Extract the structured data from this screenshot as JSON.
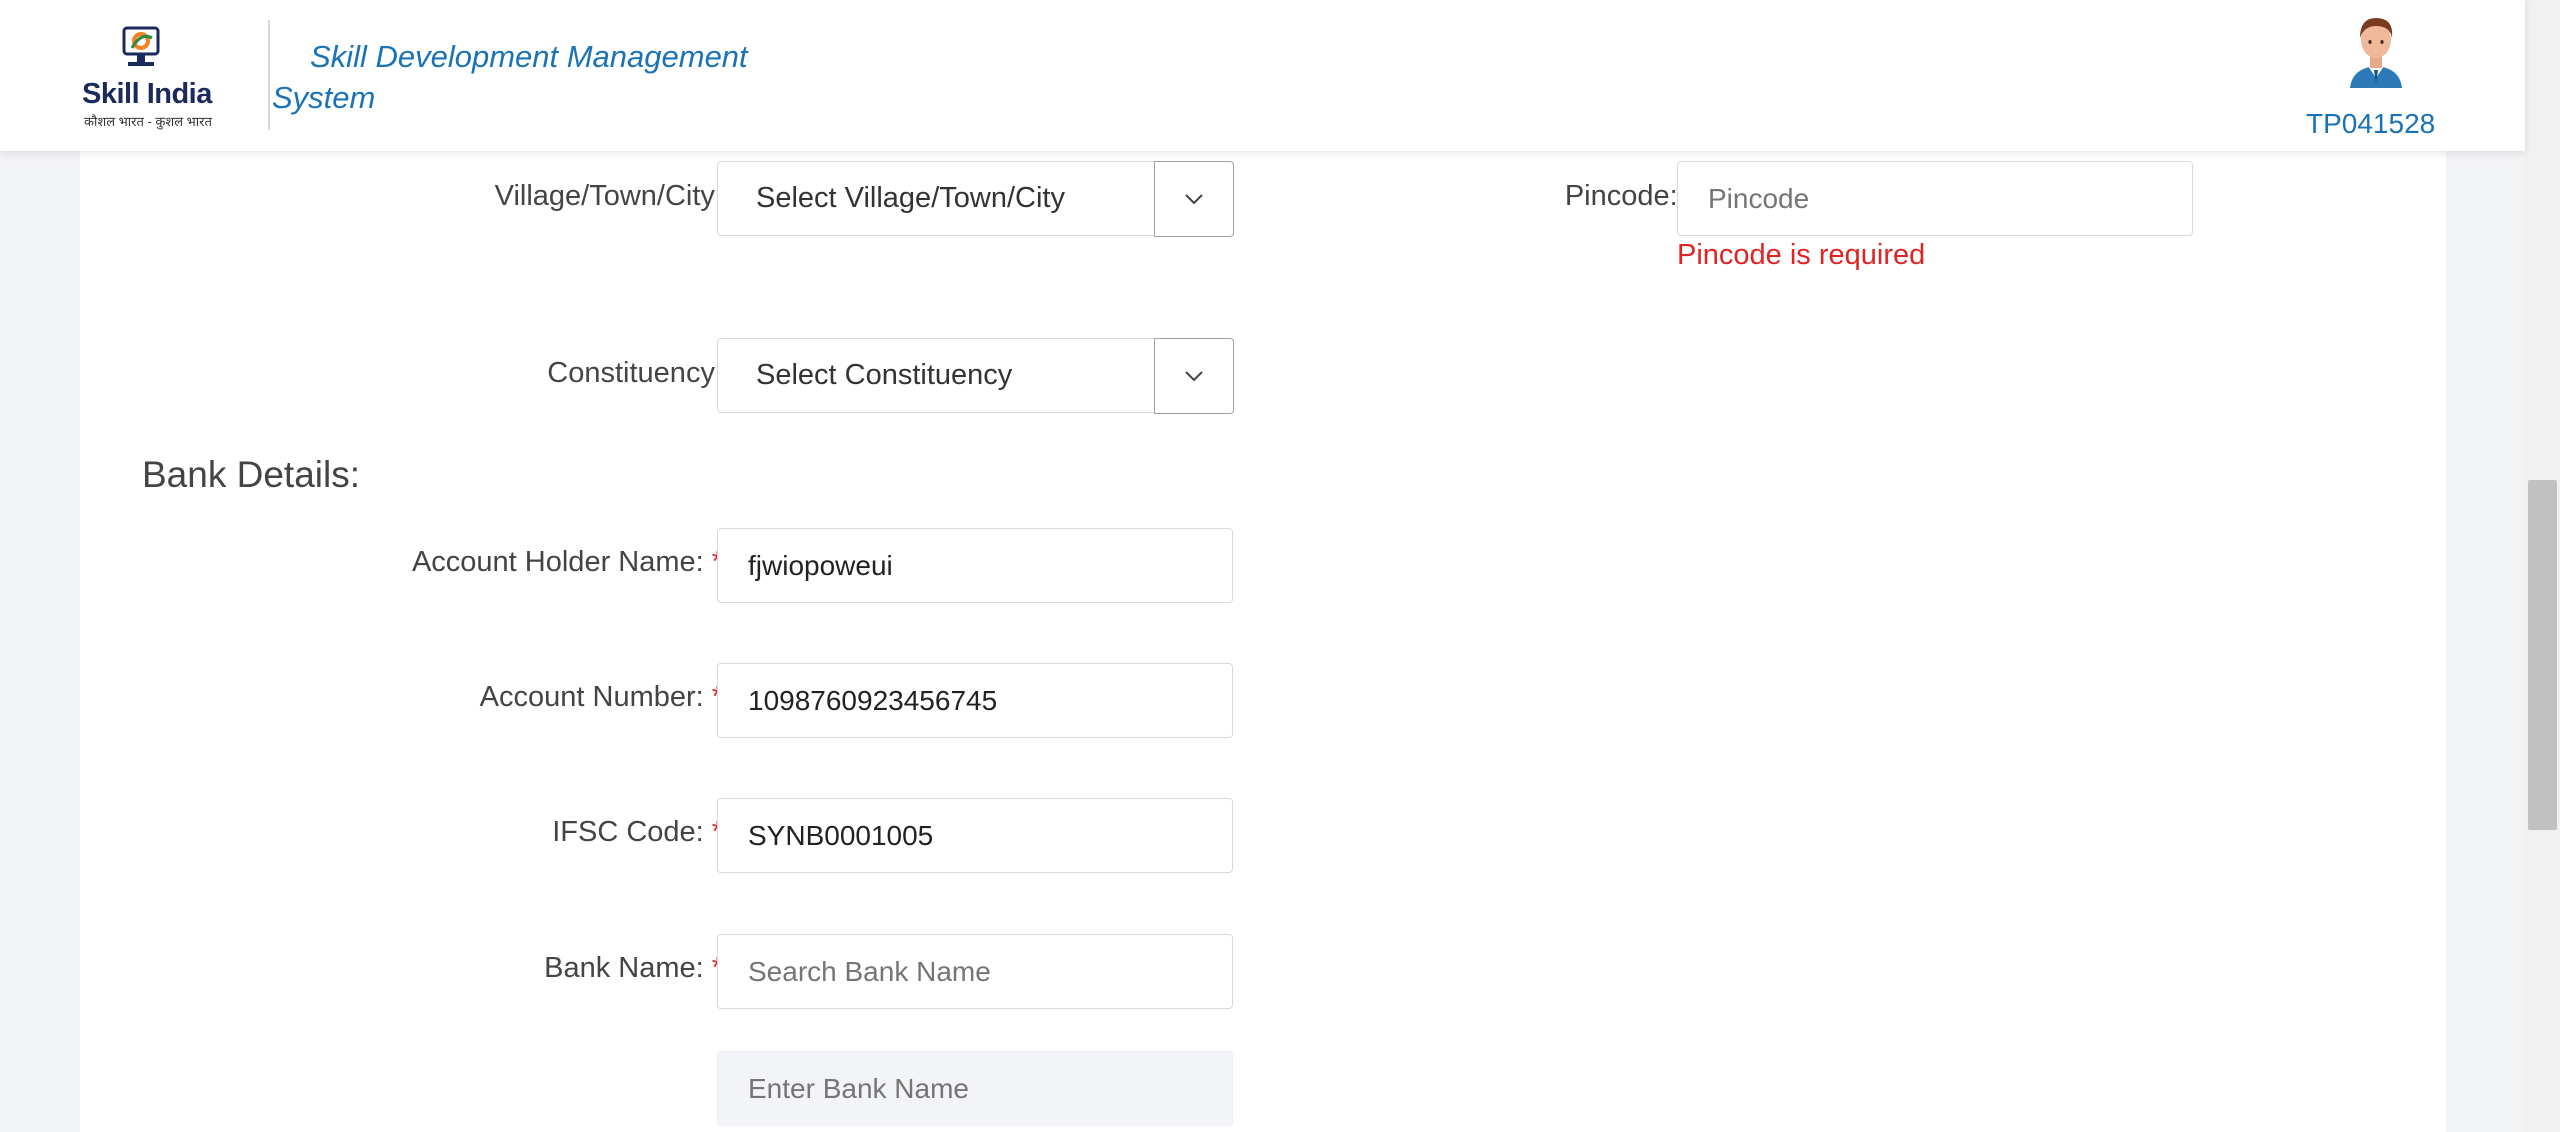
{
  "header": {
    "logo_text": "Skill India",
    "logo_subtitle": "कौशल भारत - कुशल भारत",
    "app_title": "Skill Development Management System",
    "user_id": "TP041528"
  },
  "form": {
    "village": {
      "label": "Village/Town/City:",
      "selected": "Select Village/Town/City"
    },
    "pincode": {
      "label": "Pincode:",
      "required_mark": "*",
      "placeholder": "Pincode",
      "value": "",
      "error": "Pincode is required"
    },
    "constituency": {
      "label": "Constituency:",
      "selected": "Select Constituency"
    },
    "bank_section_title": "Bank Details:",
    "account_holder": {
      "label": "Account Holder Name:",
      "required_mark": "*",
      "value": "fjwiopoweui"
    },
    "account_number": {
      "label": "Account Number:",
      "required_mark": "*",
      "value": "1098760923456745"
    },
    "ifsc": {
      "label": "IFSC Code:",
      "required_mark": "*",
      "value": "SYNB0001005"
    },
    "bank_name": {
      "label": "Bank Name:",
      "required_mark": "*",
      "placeholder": "Search Bank Name"
    },
    "bank_name_manual": {
      "placeholder": "Enter Bank Name"
    }
  },
  "colors": {
    "accent": "#1a72b8",
    "error": "#e02424",
    "brand_navy": "#1a2a5c"
  }
}
